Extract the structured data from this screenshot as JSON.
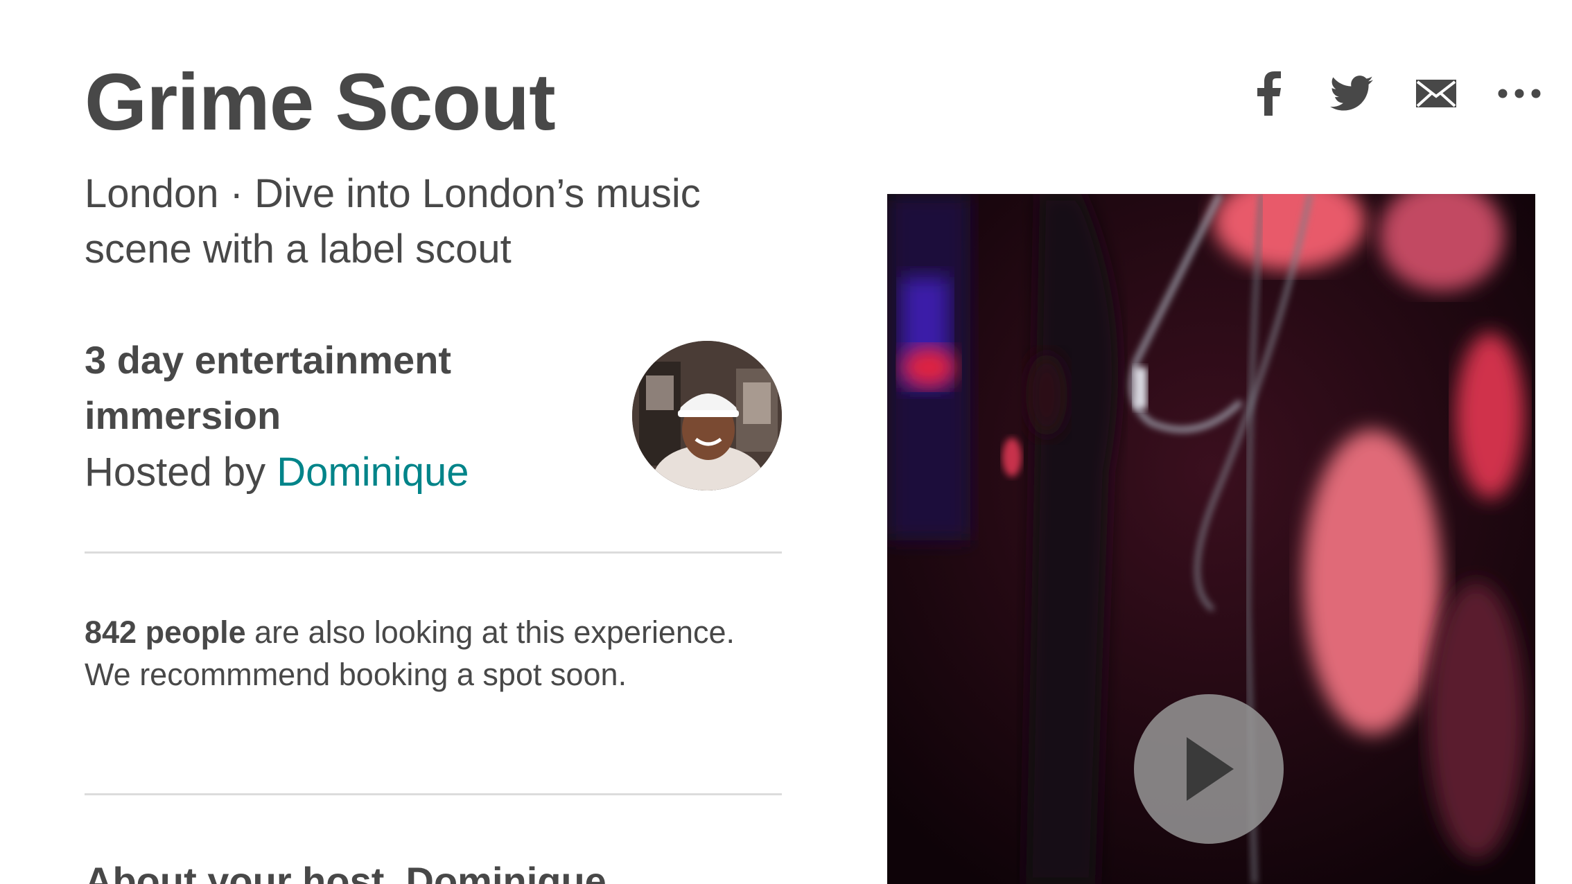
{
  "experience": {
    "title": "Grime Scout",
    "subtitle": "London · Dive into London’s music scene with a label scout",
    "type_label": "3 day entertainment immersion",
    "hosted_by_prefix": "Hosted by ",
    "host_name": "Dominique"
  },
  "notice": {
    "count_text": "842 people",
    "message": " are also looking at this experience. We recommmend booking a spot soon."
  },
  "about": {
    "heading": "About your host, Dominique"
  },
  "share": {
    "icons": [
      "facebook-icon",
      "twitter-icon",
      "email-icon",
      "more-icon"
    ]
  },
  "colors": {
    "text": "#484848",
    "link": "#008489",
    "divider": "#dcdcdc"
  }
}
